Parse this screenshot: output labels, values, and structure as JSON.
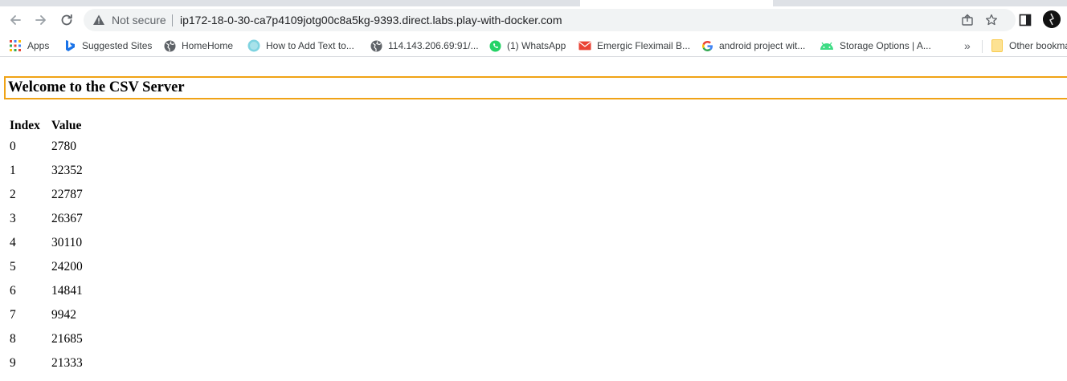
{
  "toolbar": {
    "security_label": "Not secure",
    "url": "ip172-18-0-30-ca7p4109jotg00c8a5kg-9393.direct.labs.play-with-docker.com"
  },
  "bookmarks": [
    {
      "label": "Apps",
      "icon": "apps-grid-icon"
    },
    {
      "label": "Suggested Sites",
      "icon": "bing-icon"
    },
    {
      "label": "HomeHome",
      "icon": "globe-icon"
    },
    {
      "label": "How to Add Text to...",
      "icon": "site-icon"
    },
    {
      "label": "114.143.206.69:91/...",
      "icon": "globe-icon"
    },
    {
      "label": "(1) WhatsApp",
      "icon": "whatsapp-icon"
    },
    {
      "label": "Emergic Fleximail B...",
      "icon": "mail-icon"
    },
    {
      "label": "android project wit...",
      "icon": "google-icon"
    },
    {
      "label": "Storage Options | A...",
      "icon": "android-icon"
    },
    {
      "label": "»",
      "icon": "overflow-chevron"
    },
    {
      "label": "Other bookmarks",
      "icon": "folder-icon"
    }
  ],
  "page": {
    "heading": "Welcome to the CSV Server",
    "columns": [
      "Index",
      "Value"
    ],
    "rows": [
      [
        "0",
        "2780"
      ],
      [
        "1",
        "32352"
      ],
      [
        "2",
        "22787"
      ],
      [
        "3",
        "26367"
      ],
      [
        "4",
        "30110"
      ],
      [
        "5",
        "24200"
      ],
      [
        "6",
        "14841"
      ],
      [
        "7",
        "9942"
      ],
      [
        "8",
        "21685"
      ],
      [
        "9",
        "21333"
      ]
    ]
  },
  "colors": {
    "heading_border": "#f0a316",
    "omnibox_bg": "#f1f3f4"
  }
}
